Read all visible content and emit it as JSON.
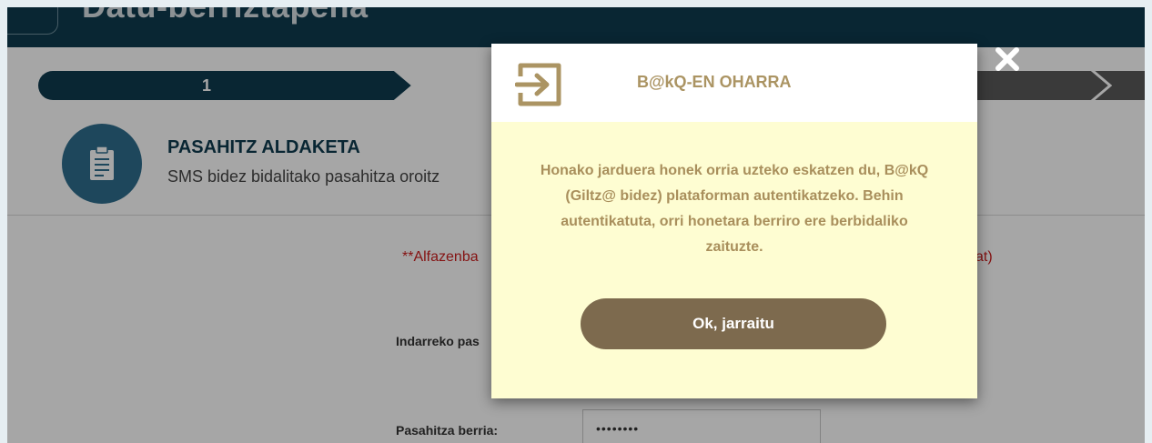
{
  "header": {
    "title": "Datu-berriztapena"
  },
  "steps": [
    {
      "number": "1"
    }
  ],
  "intro": {
    "title": "PASAHITZ ALDAKETA",
    "subtitle": "SMS bidez bidalitako pasahitza oroitz"
  },
  "form": {
    "warning_left": "**Alfazenba",
    "warning_right": "at)",
    "current_password_label": "Indarreko pas",
    "new_password_label": "Pasahitza berria:",
    "new_password_value": "••••••••"
  },
  "modal": {
    "title": "B@kQ-EN OHARRA",
    "message": "Honako jarduera honek orria uzteko eskatzen du, B@kQ (Giltz@ bidez) plataforman autentikatzeko. Behin autentikatuta, orri honetara berriro ere berbidaliko zaituzte.",
    "ok_label": "Ok, jarraitu"
  },
  "icons": {
    "close": "close-icon",
    "modal": "login-arrow-icon",
    "intro": "clipboard-icon"
  },
  "colors": {
    "primary": "#0e3b4f",
    "accent_gold": "#ab9463",
    "modal_body": "#fefdd2",
    "button": "#7d6a4e",
    "warning": "#cc1f1f"
  }
}
